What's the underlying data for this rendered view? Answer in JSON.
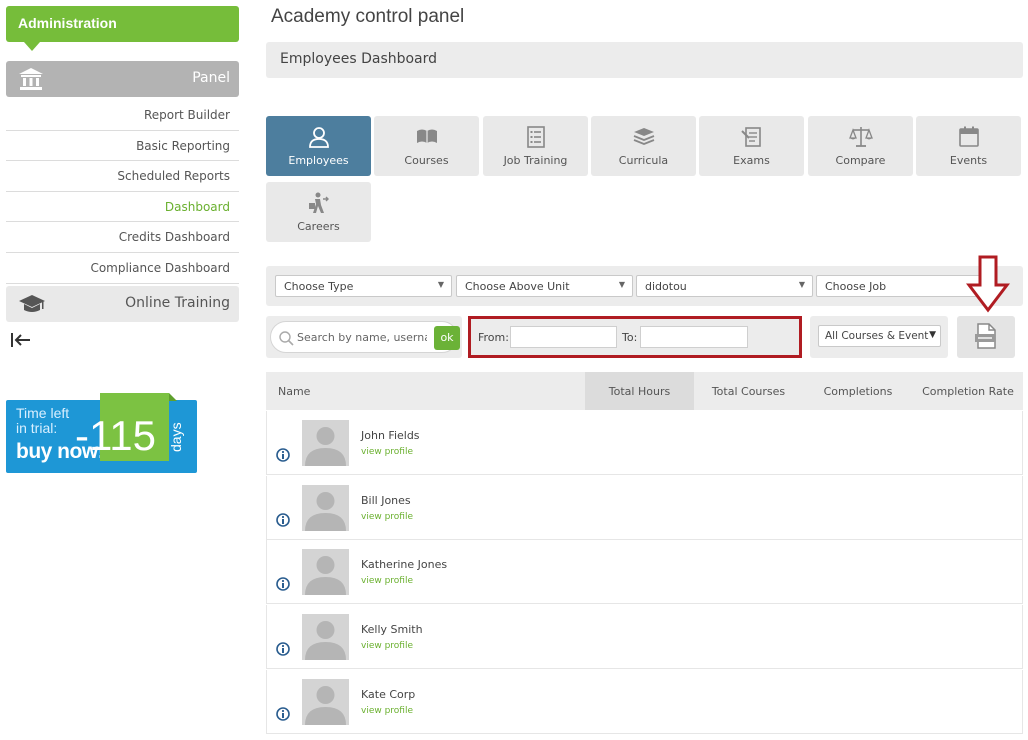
{
  "sidebar": {
    "header": "Administration",
    "panel_label": "Panel",
    "items": [
      {
        "label": "Report Builder"
      },
      {
        "label": "Basic Reporting"
      },
      {
        "label": "Scheduled Reports"
      },
      {
        "label": "Dashboard",
        "active": true
      },
      {
        "label": "Credits Dashboard"
      },
      {
        "label": "Compliance Dashboard"
      }
    ],
    "online_training_label": "Online Training"
  },
  "trial": {
    "line1": "Time left",
    "line2": "in trial:",
    "buy": "buy now!",
    "number": "-115",
    "days": "days"
  },
  "main": {
    "title": "Academy control panel",
    "subtitle": "Employees Dashboard",
    "tabs": [
      {
        "label": "Employees",
        "icon": "user-icon",
        "active": true
      },
      {
        "label": "Courses",
        "icon": "book-icon"
      },
      {
        "label": "Job Training",
        "icon": "checklist-icon"
      },
      {
        "label": "Curricula",
        "icon": "books-stack-icon"
      },
      {
        "label": "Exams",
        "icon": "exam-icon"
      },
      {
        "label": "Compare",
        "icon": "scale-icon"
      },
      {
        "label": "Events",
        "icon": "calendar-icon"
      },
      {
        "label": "Careers",
        "icon": "career-icon"
      }
    ]
  },
  "filters": {
    "type": "Choose Type",
    "above_unit": "Choose Above Unit",
    "unit": "didotou",
    "job": "Choose Job",
    "search_placeholder": "Search by name, usernar",
    "ok_label": "ok",
    "from_label": "From:",
    "to_label": "To:",
    "courses_filter": "All Courses & Event"
  },
  "table": {
    "columns": [
      "Name",
      "Total Hours",
      "Total Courses",
      "Completions",
      "Completion Rate"
    ],
    "sorted_column": "Total Hours",
    "view_profile_label": "view profile",
    "rows": [
      {
        "name": "John Fields"
      },
      {
        "name": "Bill Jones"
      },
      {
        "name": "Katherine Jones"
      },
      {
        "name": "Kelly Smith"
      },
      {
        "name": "Kate Corp"
      }
    ]
  },
  "colors": {
    "green": "#76bd3a",
    "active_tab": "#4d7e9e",
    "highlight_red": "#b01c22",
    "trial_blue": "#1e97d6"
  }
}
